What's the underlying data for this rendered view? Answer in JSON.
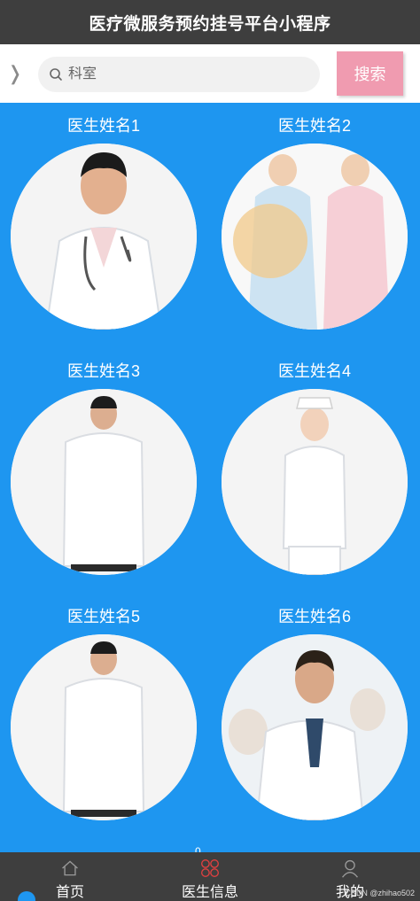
{
  "app": {
    "title": "医疗微服务预约挂号平台小程序"
  },
  "search": {
    "placeholder": "科室",
    "button_label": "搜索"
  },
  "doctors": [
    {
      "name": "医生姓名1"
    },
    {
      "name": "医生姓名2"
    },
    {
      "name": "医生姓名3"
    },
    {
      "name": "医生姓名4"
    },
    {
      "name": "医生姓名5"
    },
    {
      "name": "医生姓名6"
    }
  ],
  "tabbar": {
    "items": [
      {
        "label": "首页",
        "icon": "home-icon"
      },
      {
        "label": "医生信息",
        "icon": "grid-icon"
      },
      {
        "label": "我的",
        "icon": "user-icon"
      }
    ],
    "active_index": 1
  },
  "watermark": "CSDN @zhihao502",
  "colors": {
    "accent": "#1e96f0",
    "bar": "#3e3e3e",
    "search_button": "#f09bb0",
    "active_icon": "#e04040"
  }
}
